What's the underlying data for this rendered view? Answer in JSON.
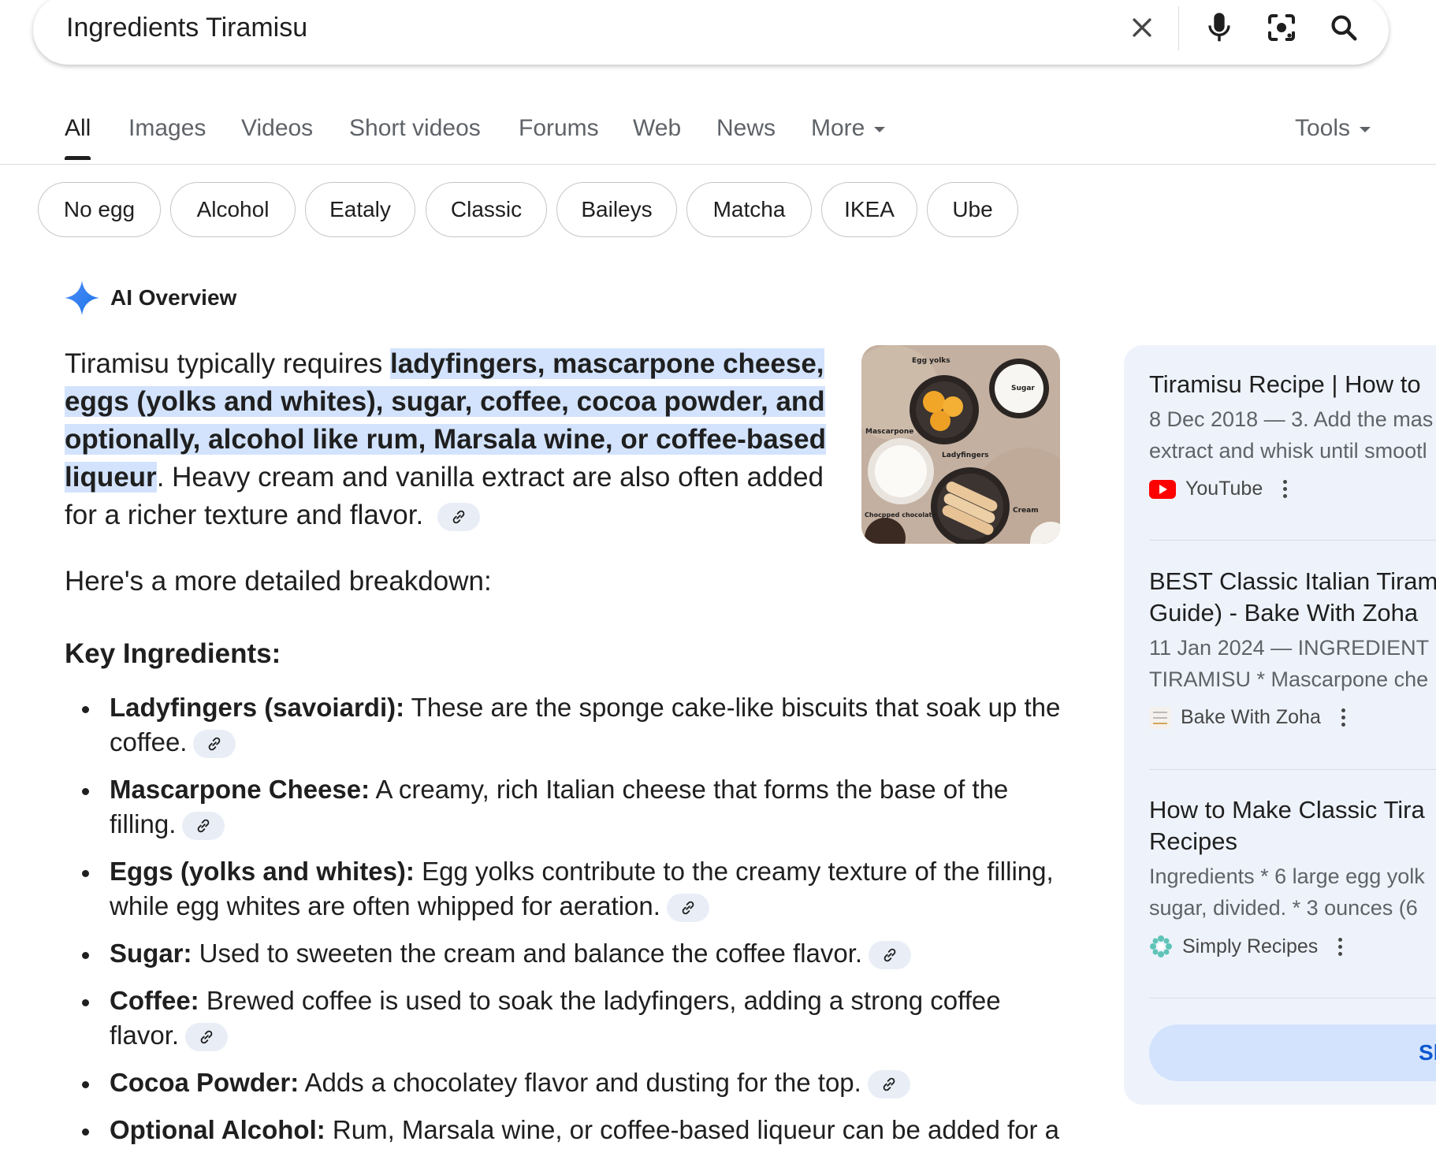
{
  "search": {
    "query": "Ingredients Tiramisu"
  },
  "icons": {
    "clear": "close-icon",
    "voice": "microphone-icon",
    "lens": "camera-lens-icon",
    "search": "search-icon"
  },
  "tabs": [
    {
      "label": "All",
      "active": true
    },
    {
      "label": "Images"
    },
    {
      "label": "Videos"
    },
    {
      "label": "Short videos"
    },
    {
      "label": "Forums"
    },
    {
      "label": "Web"
    },
    {
      "label": "News"
    },
    {
      "label": "More"
    }
  ],
  "tools_label": "Tools",
  "chips": [
    "No egg",
    "Alcohol",
    "Eataly",
    "Classic",
    "Baileys",
    "Matcha",
    "IKEA",
    "Ube"
  ],
  "ai_overview": {
    "title": "AI Overview",
    "intro_before": "Tiramisu typically requires ",
    "intro_highlight": "ladyfingers, mascarpone cheese, eggs (yolks and whites), sugar, coffee, cocoa powder, and optionally, alcohol like rum, Marsala wine, or coffee-based liqueur",
    "intro_after": ". Heavy cream and vanilla extract are also often added for a richer texture and flavor.",
    "image_labels": {
      "egg_yolks": "Egg yolks",
      "sugar": "Sugar",
      "mascarpone": "Mascarpone",
      "ladyfingers": "Ladyfingers",
      "chocolate": "Chocpped chocolate",
      "cream": "Cream"
    },
    "breakdown": "Here's a more detailed breakdown:",
    "key_heading": "Key Ingredients:",
    "ingredients": [
      {
        "name": "Ladyfingers (savoiardi):",
        "text": " These are the sponge cake-like biscuits that soak up the coffee."
      },
      {
        "name": "Mascarpone Cheese:",
        "text": " A creamy, rich Italian cheese that forms the base of the filling."
      },
      {
        "name": "Eggs (yolks and whites):",
        "text": " Egg yolks contribute to the creamy texture of the filling, while egg whites are often whipped for aeration."
      },
      {
        "name": "Sugar:",
        "text": " Used to sweeten the cream and balance the coffee flavor."
      },
      {
        "name": "Coffee:",
        "text": " Brewed coffee is used to soak the ladyfingers, adding a strong coffee flavor."
      },
      {
        "name": "Cocoa Powder:",
        "text": " Adds a chocolatey flavor and dusting for the top."
      },
      {
        "name": "Optional Alcohol:",
        "text": " Rum, Marsala wine, or coffee-based liqueur can be added for a"
      }
    ]
  },
  "sources": [
    {
      "title_lines": [
        "Tiramisu Recipe | How to"
      ],
      "snippet_lines": [
        "8 Dec 2018 — 3. Add the mas",
        "extract and whisk until smootl"
      ],
      "site": "YouTube",
      "site_icon": "youtube-icon",
      "color": "#ff0000"
    },
    {
      "title_lines": [
        "BEST Classic Italian Tiram",
        "Guide) - Bake With Zoha"
      ],
      "snippet_lines": [
        "11 Jan 2024 — INGREDIENT",
        "TIRAMISU * Mascarpone che"
      ],
      "site": "Bake With Zoha",
      "site_icon": "bake-with-zoha-logo-icon"
    },
    {
      "title_lines": [
        "How to Make Classic Tira",
        "Recipes"
      ],
      "snippet_lines": [
        "Ingredients * 6 large egg yolk",
        "sugar, divided. * 3 ounces (6 "
      ],
      "site": "Simply Recipes",
      "site_icon": "simply-recipes-flower-icon",
      "color": "#5fc4b8"
    }
  ],
  "show_all_label": "Sl"
}
